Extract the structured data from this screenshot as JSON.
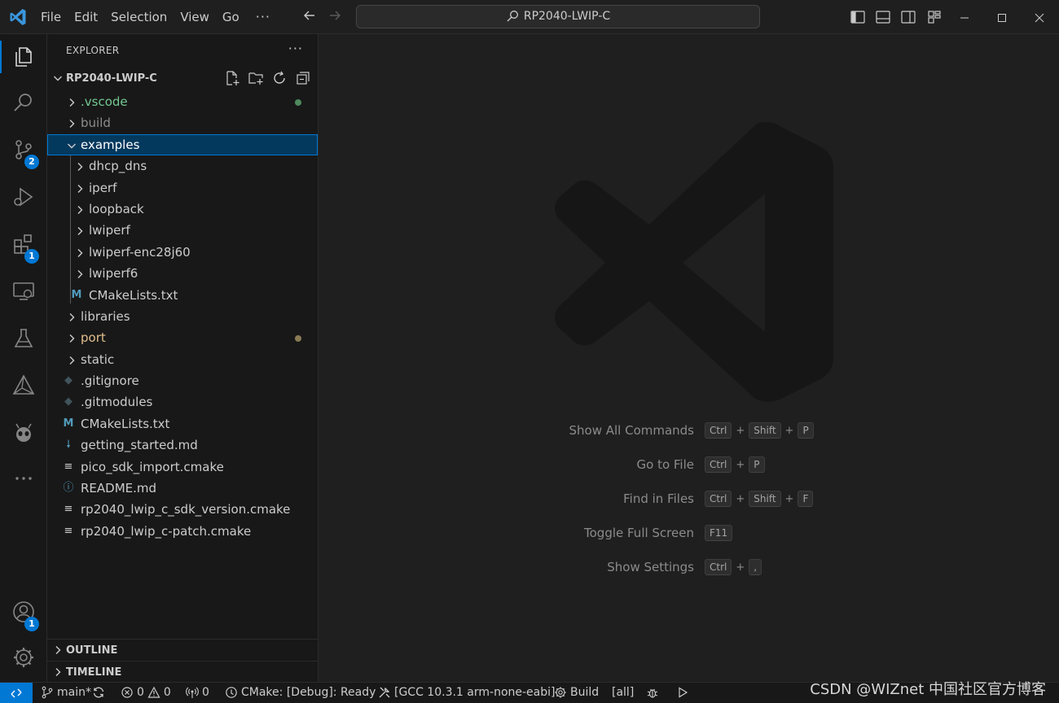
{
  "titlebar": {
    "menu": [
      "File",
      "Edit",
      "Selection",
      "View",
      "Go"
    ],
    "more": "···",
    "search_text": "RP2040-LWIP-C",
    "window_controls": [
      "minimize-icon",
      "maximize-icon",
      "close-icon"
    ],
    "layout_icons": [
      "toggle-primary-sidebar-icon",
      "toggle-panel-icon",
      "toggle-secondary-sidebar-icon",
      "customize-layout-icon"
    ]
  },
  "activitybar": {
    "items": [
      {
        "name": "explorer-icon",
        "active": true
      },
      {
        "name": "search-icon"
      },
      {
        "name": "source-control-icon",
        "badge": "2"
      },
      {
        "name": "run-debug-icon"
      },
      {
        "name": "extensions-icon",
        "badge": "1"
      },
      {
        "name": "remote-explorer-icon"
      },
      {
        "name": "testing-icon"
      },
      {
        "name": "cmake-icon"
      },
      {
        "name": "platformio-icon"
      },
      {
        "name": "more-icon"
      }
    ],
    "accounts_badge": "1"
  },
  "explorer": {
    "title": "EXPLORER",
    "more": "···",
    "root": "RP2040-LWIP-C",
    "tree": [
      {
        "label": ".vscode",
        "type": "folder",
        "depth": 0,
        "color": "#73c991",
        "dot": "#4e8a5e"
      },
      {
        "label": "build",
        "type": "folder",
        "depth": 0,
        "color": "#8c8c8c"
      },
      {
        "label": "examples",
        "type": "folder",
        "depth": 0,
        "open": true,
        "selected": true
      },
      {
        "label": "dhcp_dns",
        "type": "folder",
        "depth": 1
      },
      {
        "label": "iperf",
        "type": "folder",
        "depth": 1
      },
      {
        "label": "loopback",
        "type": "folder",
        "depth": 1
      },
      {
        "label": "lwiperf",
        "type": "folder",
        "depth": 1
      },
      {
        "label": "lwiperf-enc28j60",
        "type": "folder",
        "depth": 1
      },
      {
        "label": "lwiperf6",
        "type": "folder",
        "depth": 1
      },
      {
        "label": "CMakeLists.txt",
        "type": "file",
        "depth": 1,
        "icon": "M",
        "icon_color": "#519aba"
      },
      {
        "label": "libraries",
        "type": "folder",
        "depth": 0
      },
      {
        "label": "port",
        "type": "folder",
        "depth": 0,
        "color": "#e2c08d",
        "dot": "#8a7a55"
      },
      {
        "label": "static",
        "type": "folder",
        "depth": 0
      },
      {
        "label": ".gitignore",
        "type": "file",
        "depth": 0,
        "icon": "◆",
        "icon_color": "#41535b"
      },
      {
        "label": ".gitmodules",
        "type": "file",
        "depth": 0,
        "icon": "◆",
        "icon_color": "#41535b"
      },
      {
        "label": "CMakeLists.txt",
        "type": "file",
        "depth": 0,
        "icon": "M",
        "icon_color": "#519aba"
      },
      {
        "label": "getting_started.md",
        "type": "file",
        "depth": 0,
        "icon": "🠗",
        "icon_color": "#519aba"
      },
      {
        "label": "pico_sdk_import.cmake",
        "type": "file",
        "depth": 0,
        "icon": "≡",
        "icon_color": "#cccccc"
      },
      {
        "label": "README.md",
        "type": "file",
        "depth": 0,
        "icon": "ⓘ",
        "icon_color": "#519aba"
      },
      {
        "label": "rp2040_lwip_c_sdk_version.cmake",
        "type": "file",
        "depth": 0,
        "icon": "≡",
        "icon_color": "#cccccc"
      },
      {
        "label": "rp2040_lwip_c-patch.cmake",
        "type": "file",
        "depth": 0,
        "icon": "≡",
        "icon_color": "#cccccc"
      }
    ],
    "outline": "OUTLINE",
    "timeline": "TIMELINE"
  },
  "editor": {
    "shortcuts": [
      {
        "label": "Show All Commands",
        "keys": [
          "Ctrl",
          "Shift",
          "P"
        ]
      },
      {
        "label": "Go to File",
        "keys": [
          "Ctrl",
          "P"
        ]
      },
      {
        "label": "Find in Files",
        "keys": [
          "Ctrl",
          "Shift",
          "F"
        ]
      },
      {
        "label": "Toggle Full Screen",
        "keys": [
          "F11"
        ]
      },
      {
        "label": "Show Settings",
        "keys": [
          "Ctrl",
          ","
        ]
      }
    ]
  },
  "statusbar": {
    "branch": "main*",
    "errors": "0",
    "warnings": "0",
    "ports": "0",
    "cmake_status": "CMake: [Debug]: Ready",
    "kit": "[GCC 10.3.1 arm-none-eabi]",
    "build": "Build",
    "target": "[all]"
  },
  "watermark_text": "CSDN @WIZnet 中国社区官方博客"
}
